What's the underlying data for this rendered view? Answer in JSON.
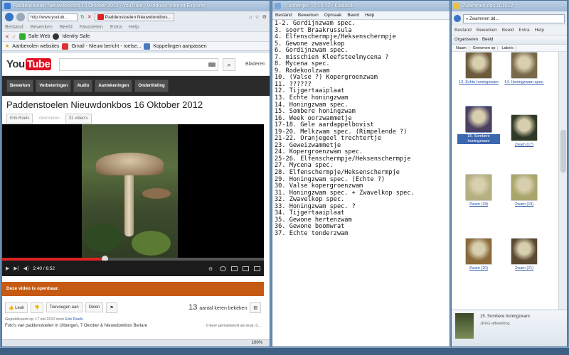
{
  "ie": {
    "title": "Paddenstoelen Nieuwdonkbos 16 Oktober 2012 - YouTube - Windows Internet Explorer",
    "url": "http://www.youtub...",
    "tab_label": "Paddenstoelen Nieuwdonkbos...",
    "menu": [
      "Bestand",
      "Bewerken",
      "Beeld",
      "Favorieten",
      "Extra",
      "Help"
    ],
    "commands": [
      "Safe Web",
      "Identity Safe"
    ],
    "favorites": [
      "Aanbevolen websites",
      "Gmail - Nieuw bericht - roelse...",
      "Koppelingen aanpassen"
    ],
    "zoom": "100%"
  },
  "youtube": {
    "logo_you": "You",
    "logo_tube": "Tube",
    "browse": "Bladeren",
    "tools": [
      "Bewerken",
      "Verbeteringen",
      "Audio",
      "Aantekeningen",
      "Ondertiteling"
    ],
    "video_title": "Paddenstoelen Nieuwdonkbos 16 Oktober 2012",
    "owner": "Erik Roels",
    "subscribe": "Abonneren",
    "video_count": "31 video's",
    "time": "2:40 / 6:52",
    "progress_fraction": 0.39,
    "public_notice": "Deze video is openbaar.",
    "like": "Leuk",
    "add_to": "Toevoegen aan",
    "share": "Delen",
    "view_count": "13",
    "views_label": "aantal keren bekeken",
    "published": "Gepubliceerd op 17 okt 2012 door",
    "publisher": "Erik Roels",
    "likes_note": "0 keer gemarkeerd als leuk, 0...",
    "description": "Foto's van paddenstoelen in Uitbergen, 7 Oktober & Nieuwdonkbos Berlare"
  },
  "notepad": {
    "title": "... uitbergen 07.10.12 - Kladblok",
    "menu": [
      "Bestand",
      "Bewerken",
      "Opmaak",
      "Beeld",
      "Help"
    ],
    "lines": [
      "1-2. Gordijnzwam spec.",
      "3. soort Braakrussula",
      "4. Elfenschermpje/Heksenschermpje",
      "5. Gewone zwavelkop",
      "6. Gordijnzwam spec.",
      "7. misschien Kleefsteelmycena ?",
      "8. Mycena spec.",
      "9. Rodekoolzwam",
      "10. (Valse ?) Kopergroenzwam",
      "11. ??????",
      "12. Tijgertaaiplaat",
      "13. Echte honingzwam",
      "14. Honingzwam spec.",
      "15. Sombere honingzwam",
      "16. Week oorzwammetje",
      "17-18. Gele aardappelbovist",
      "19-20. Melkzwam spec. (Rimpelende ?)",
      "21-22. Oranjegeel trechtertje",
      "23. Geweizwammetje",
      "24. Kopergroenzwam spec.",
      "25-26. Elfenschermpje/Heksenschermpje",
      "27. Mycena spec.",
      "28. Elfenschermpje/Heksenschermpje",
      "29. Honingzwam spec. (Echte ?)",
      "30. Valse kopergroenzwam",
      "31. Honingzwam spec. + Zwavelkop spec.",
      "32. Zwavelkop spec.",
      "33. Honingzwam spec. ?",
      "34. Tijgertaaiplaat",
      "35. Gewone hertenzwam",
      "36. Gewone boomwrat",
      "37. Echte tonderzwam"
    ]
  },
  "explorer": {
    "title": "Zwammen dds 161012",
    "address": "« Zwammen dd...",
    "menu": [
      "Bestand",
      "Bewerken",
      "Beeld",
      "Extra",
      "Help"
    ],
    "toolbar": [
      "Organiseren",
      "Beeld"
    ],
    "columns": [
      "Naam",
      "Genomen op",
      "Labels"
    ],
    "thumbs": [
      {
        "label": "13. Echte honingzwam",
        "color": "#6b5a3c"
      },
      {
        "label": "14. Honingzwam spec.",
        "color": "#7a6a4a"
      },
      {
        "label": "15. Sombere honingzwam",
        "color": "#4a4060",
        "selected": true
      },
      {
        "label": "Zwam (17)",
        "color": "#2f3a26"
      },
      {
        "label": "Zwam (18)",
        "color": "#b5b082"
      },
      {
        "label": "Zwam (19)",
        "color": "#a8a66a"
      },
      {
        "label": "Zwam (20)",
        "color": "#8a6a3a"
      },
      {
        "label": "Zwam (21)",
        "color": "#5a4a32"
      }
    ],
    "details_title": "15. Sombere honingzwam",
    "details_type": "JPEG-afbeelding"
  }
}
